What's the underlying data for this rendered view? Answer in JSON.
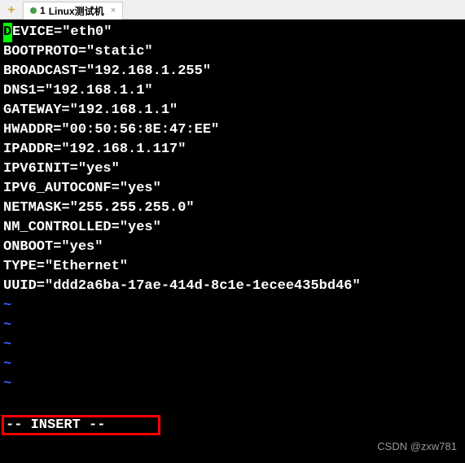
{
  "tabs": {
    "add_icon": "+",
    "active": {
      "index": "1",
      "label": "Linux测试机",
      "close": "×"
    }
  },
  "editor": {
    "first_char": "D",
    "first_rest": "EVICE=\"eth0\"",
    "lines": [
      "BOOTPROTO=\"static\"",
      "BROADCAST=\"192.168.1.255\"",
      "DNS1=\"192.168.1.1\"",
      "GATEWAY=\"192.168.1.1\"",
      "HWADDR=\"00:50:56:8E:47:EE\"",
      "IPADDR=\"192.168.1.117\"",
      "IPV6INIT=\"yes\"",
      "IPV6_AUTOCONF=\"yes\"",
      "NETMASK=\"255.255.255.0\"",
      "NM_CONTROLLED=\"yes\"",
      "ONBOOT=\"yes\"",
      "TYPE=\"Ethernet\"",
      "UUID=\"ddd2a6ba-17ae-414d-8c1e-1ecee435bd46\""
    ],
    "tildes": [
      "~",
      "~",
      "~",
      "~",
      "~"
    ],
    "status": "-- INSERT --"
  },
  "watermark": "CSDN @zxw781"
}
